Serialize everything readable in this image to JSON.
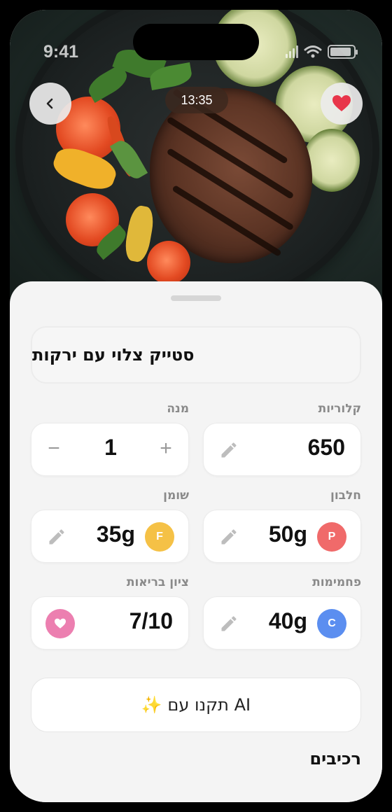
{
  "status_bar": {
    "time": "9:41"
  },
  "photo": {
    "cook_time": "13:35"
  },
  "recipe": {
    "title": "סטייק צלוי עם ירקות"
  },
  "nutrition": {
    "calories": {
      "label": "קלוריות",
      "value": "650"
    },
    "servings": {
      "label": "מנה",
      "value": "1",
      "minus": "−",
      "plus": "+"
    },
    "protein": {
      "label": "חלבון",
      "value": "50g",
      "badge": "P",
      "color": "#f06a6a"
    },
    "fat": {
      "label": "שומן",
      "value": "35g",
      "badge": "F",
      "color": "#f5c146"
    },
    "carbs": {
      "label": "פחמימות",
      "value": "40g",
      "badge": "C",
      "color": "#5b8ef0"
    },
    "health": {
      "label": "ציון בריאות",
      "value": "7/10",
      "color": "#ec7fb0"
    }
  },
  "actions": {
    "ai_fix": "✨ תקנו עם AI"
  },
  "sections": {
    "ingredients_title": "רכיבים"
  },
  "colors": {
    "favorite": "#e8364a",
    "sheet_bg": "#f4f4f4"
  },
  "icons": {
    "back": "chevron-left-icon",
    "favorite": "heart-icon",
    "edit": "pencil-icon",
    "health": "heart-icon"
  }
}
